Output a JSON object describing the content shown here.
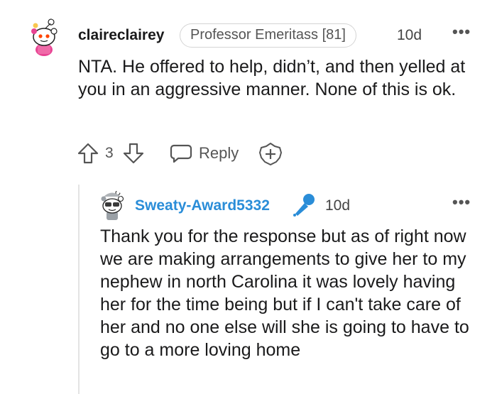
{
  "comment": {
    "username": "claireclairey",
    "flair": "Professor Emeritass [81]",
    "time": "10d",
    "more": "•••",
    "body": "NTA. He offered to help, didn’t, and then yelled at you in an aggressive manner. None of this is ok.",
    "vote_count": "3",
    "reply_label": "Reply",
    "icons": [
      "avatar",
      "upvote-icon",
      "downvote-icon",
      "reply-icon",
      "award-icon",
      "more-icon"
    ]
  },
  "reply": {
    "username": "Sweaty-Award5332",
    "time": "10d",
    "more": "•••",
    "body": "Thank you for the response but as of right now we are making arrangements to give her to my nephew in north Carolina it was lovely having her for the time being but if I can't take care of her and no one else will she is going to have to go to a more loving home",
    "icons": [
      "avatar",
      "microphone-icon",
      "more-icon"
    ]
  },
  "colors": {
    "op_username": "#2a8dd8",
    "mic": "#2a8dd8",
    "text": "#1a1a1b",
    "muted": "#555555"
  }
}
